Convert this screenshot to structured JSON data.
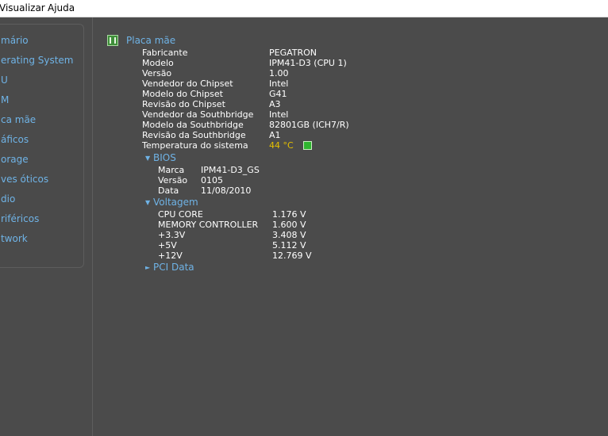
{
  "menu": {
    "visualizar": "Visualizar",
    "ajuda": "Ajuda"
  },
  "sidebar": {
    "items": [
      {
        "label": "mário"
      },
      {
        "label": "erating System"
      },
      {
        "label": "U"
      },
      {
        "label": "M"
      },
      {
        "label": "ca mãe"
      },
      {
        "label": "áficos"
      },
      {
        "label": "orage"
      },
      {
        "label": "ves óticos"
      },
      {
        "label": "dio"
      },
      {
        "label": "riféricos"
      },
      {
        "label": "twork"
      }
    ]
  },
  "main": {
    "title": "Placa mãe",
    "icon": "motherboard-icon",
    "properties": [
      {
        "label": "Fabricante",
        "value": "PEGATRON"
      },
      {
        "label": "Modelo",
        "value": "IPM41-D3 (CPU 1)"
      },
      {
        "label": "Versão",
        "value": "1.00"
      },
      {
        "label": "Vendedor do Chipset",
        "value": "Intel"
      },
      {
        "label": "Modelo do Chipset",
        "value": "G41"
      },
      {
        "label": "Revisão do Chipset",
        "value": "A3"
      },
      {
        "label": "Vendedor da Southbridge",
        "value": "Intel"
      },
      {
        "label": "Modelo da Southbridge",
        "value": "82801GB (ICH7/R)"
      },
      {
        "label": "Revisão da Southbridge",
        "value": "A1"
      },
      {
        "label": "Temperatura do sistema",
        "value": "44 °C"
      }
    ],
    "temp_color": "#e6c000",
    "bios": {
      "title": "BIOS",
      "expanded": true,
      "rows": [
        {
          "label": "Marca",
          "value": "IPM41-D3_GS"
        },
        {
          "label": "Versão",
          "value": "0105"
        },
        {
          "label": "Data",
          "value": "11/08/2010"
        }
      ]
    },
    "voltagem": {
      "title": "Voltagem",
      "expanded": true,
      "rows": [
        {
          "label": "CPU CORE",
          "value": "1.176 V"
        },
        {
          "label": "MEMORY CONTROLLER",
          "value": "1.600 V"
        },
        {
          "label": "+3.3V",
          "value": "3.408 V"
        },
        {
          "label": "+5V",
          "value": "5.112 V"
        },
        {
          "label": "+12V",
          "value": "12.769 V"
        }
      ]
    },
    "pci": {
      "title": "PCI Data",
      "expanded": false
    }
  },
  "colors": {
    "background": "#4b4b4b",
    "link": "#6fb3e6",
    "text": "#ffffff",
    "warning": "#e6c000"
  }
}
